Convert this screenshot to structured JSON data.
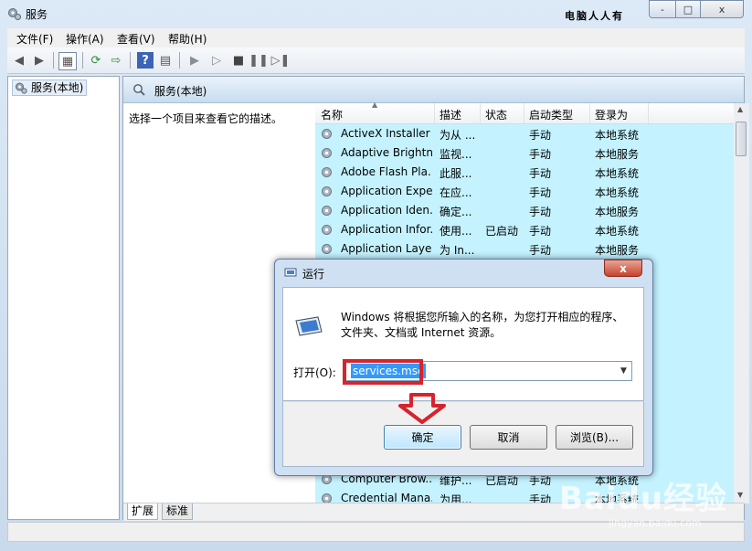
{
  "window": {
    "title": "服务",
    "watermark": "电脑人人有",
    "caption_buttons": [
      "-",
      "□",
      "x"
    ]
  },
  "menubar": [
    "文件(F)",
    "操作(A)",
    "查看(V)",
    "帮助(H)"
  ],
  "tree": {
    "item": "服务(本地)"
  },
  "main": {
    "header": "服务(本地)",
    "description_hint": "选择一个项目来查看它的描述。",
    "columns": [
      "名称",
      "描述",
      "状态",
      "启动类型",
      "登录为"
    ],
    "rows": [
      [
        "ActiveX Installer ...",
        "为从 ...",
        "",
        "手动",
        "本地系统"
      ],
      [
        "Adaptive Brightn...",
        "监视...",
        "",
        "手动",
        "本地服务"
      ],
      [
        "Adobe Flash Pla...",
        "此服...",
        "",
        "手动",
        "本地系统"
      ],
      [
        "Application Expe...",
        "在应...",
        "",
        "手动",
        "本地系统"
      ],
      [
        "Application Iden...",
        "确定...",
        "",
        "手动",
        "本地服务"
      ],
      [
        "Application Infor...",
        "使用...",
        "已启动",
        "手动",
        "本地系统"
      ],
      [
        "Application Laye...",
        "为 In...",
        "",
        "手动",
        "本地服务"
      ]
    ],
    "bottom_rows": [
      [
        "Computer Brow...",
        "维护...",
        "已启动",
        "手动",
        "本地系统"
      ],
      [
        "Credential Mana...",
        "为用...",
        "",
        "手动",
        "本地系统"
      ]
    ],
    "tabs": [
      "扩展",
      "标准"
    ]
  },
  "run_dialog": {
    "title": "运行",
    "close": "x",
    "message": "Windows 将根据您所输入的名称，为您打开相应的程序、文件夹、文档或 Internet 资源。",
    "open_label": "打开(O):",
    "open_value": "services.msc",
    "buttons": {
      "ok": "确定",
      "cancel": "取消",
      "browse": "浏览(B)..."
    }
  },
  "watermark": {
    "brand": "Baidu经验",
    "url": "jingyan.baidu.com"
  },
  "colors": {
    "highlight": "#d6242d",
    "list_bg": "#c4f3ff",
    "selection": "#3399ff"
  }
}
